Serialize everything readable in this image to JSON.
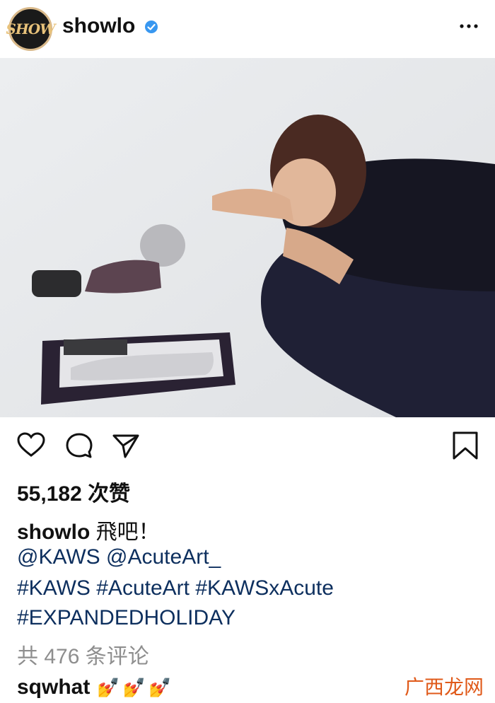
{
  "post": {
    "username": "showlo",
    "avatar_text": "SHOW",
    "likes": "55,182 次赞",
    "caption_user": "showlo",
    "caption_text": " 飛吧！",
    "lines": [
      "@KAWS @AcuteArt_",
      "#KAWS #AcuteArt #KAWSxAcute",
      "#EXPANDEDHOLIDAY"
    ],
    "comments_count": "共 476 条评论",
    "comment_user": "sqwhat",
    "comment_text": "💅💅💅",
    "watermark": "广西龙网"
  },
  "icons": {
    "verified": "verified-badge-icon",
    "more": "more-options-icon",
    "like": "heart-icon",
    "comment": "comment-icon",
    "share": "share-icon",
    "save": "bookmark-icon"
  },
  "colors": {
    "hashtag": "#0d2f5e",
    "muted": "#8e8e8e",
    "verified": "#3897f0",
    "watermark": "#e05a1a"
  }
}
